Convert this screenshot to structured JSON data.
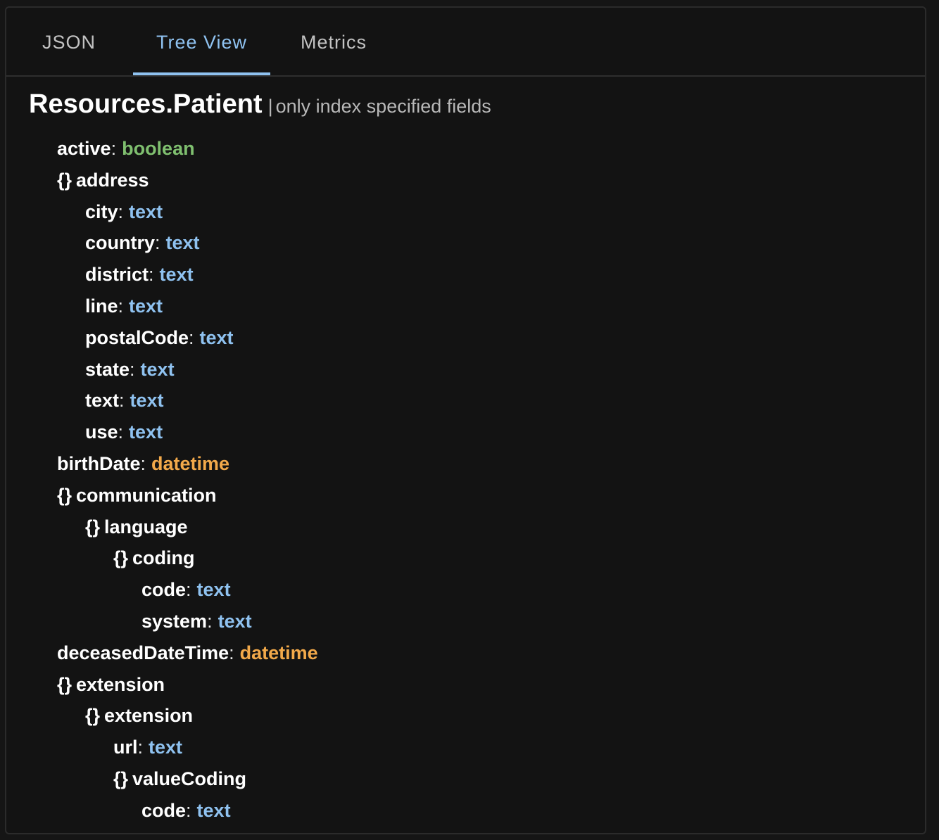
{
  "tabs": [
    {
      "label": "JSON",
      "active": false
    },
    {
      "label": "Tree View",
      "active": true
    },
    {
      "label": "Metrics",
      "active": false
    }
  ],
  "heading": {
    "title": "Resources.Patient",
    "separator": "|",
    "subtitle": "only index specified fields"
  },
  "colors": {
    "text_type": "#8fc2f0",
    "boolean_type": "#7fbf6f",
    "datetime_type": "#f2a94a",
    "active_tab": "#8fc2f0"
  },
  "tree": [
    {
      "level": 1,
      "kind": "field",
      "name": "active",
      "type": "boolean"
    },
    {
      "level": 1,
      "kind": "object",
      "brace": "{}",
      "name": "address"
    },
    {
      "level": 2,
      "kind": "field",
      "name": "city",
      "type": "text"
    },
    {
      "level": 2,
      "kind": "field",
      "name": "country",
      "type": "text"
    },
    {
      "level": 2,
      "kind": "field",
      "name": "district",
      "type": "text"
    },
    {
      "level": 2,
      "kind": "field",
      "name": "line",
      "type": "text"
    },
    {
      "level": 2,
      "kind": "field",
      "name": "postalCode",
      "type": "text"
    },
    {
      "level": 2,
      "kind": "field",
      "name": "state",
      "type": "text"
    },
    {
      "level": 2,
      "kind": "field",
      "name": "text",
      "type": "text"
    },
    {
      "level": 2,
      "kind": "field",
      "name": "use",
      "type": "text"
    },
    {
      "level": 1,
      "kind": "field",
      "name": "birthDate",
      "type": "datetime"
    },
    {
      "level": 1,
      "kind": "object",
      "brace": "{}",
      "name": "communication"
    },
    {
      "level": 2,
      "kind": "object",
      "brace": "{}",
      "name": "language"
    },
    {
      "level": 3,
      "kind": "object",
      "brace": "{}",
      "name": "coding"
    },
    {
      "level": 4,
      "kind": "field",
      "name": "code",
      "type": "text"
    },
    {
      "level": 4,
      "kind": "field",
      "name": "system",
      "type": "text"
    },
    {
      "level": 1,
      "kind": "field",
      "name": "deceasedDateTime",
      "type": "datetime"
    },
    {
      "level": 1,
      "kind": "object",
      "brace": "{}",
      "name": "extension"
    },
    {
      "level": 2,
      "kind": "object",
      "brace": "{}",
      "name": "extension"
    },
    {
      "level": 3,
      "kind": "field",
      "name": "url",
      "type": "text"
    },
    {
      "level": 3,
      "kind": "object",
      "brace": "{}",
      "name": "valueCoding"
    },
    {
      "level": 4,
      "kind": "field",
      "name": "code",
      "type": "text"
    }
  ]
}
